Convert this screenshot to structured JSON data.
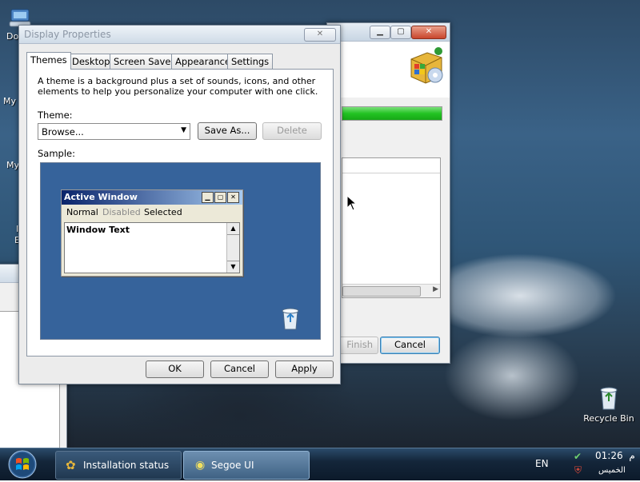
{
  "desktop": {
    "icons": [
      {
        "label": "Do",
        "icon": "network-icon"
      },
      {
        "label": "My",
        "icon": "documents-icon"
      },
      {
        "label": "My",
        "icon": "computer-icon"
      },
      {
        "label": "I",
        "icon": "ie-icon"
      },
      {
        "label": "E",
        "icon": "ie-icon"
      }
    ],
    "recycle_bin": "Recycle Bin"
  },
  "display_properties": {
    "title": "Display Properties",
    "tabs": [
      "Themes",
      "Desktop",
      "Screen Saver",
      "Appearance",
      "Settings"
    ],
    "active_tab": "Themes",
    "description": "A theme is a background plus a set of sounds, icons, and other elements to help you personalize your computer with one click.",
    "theme_label": "Theme:",
    "theme_value": "Browse...",
    "save_as": "Save As...",
    "delete": "Delete",
    "sample_label": "Sample:",
    "preview": {
      "title": "Active Window",
      "menu": [
        "Normal",
        "Disabled",
        "Selected"
      ],
      "text": "Window Text"
    },
    "ok": "OK",
    "cancel": "Cancel",
    "apply": "Apply"
  },
  "installer": {
    "finish": "Finish",
    "cancel": "Cancel",
    "progress": 100,
    "progress_color": "#22c322"
  },
  "taskbar": {
    "items": [
      {
        "label": "Installation status"
      },
      {
        "label": "Segoe UI"
      }
    ],
    "lang": "EN",
    "time": "01:26",
    "ampm": "م",
    "day": "الخميس"
  }
}
